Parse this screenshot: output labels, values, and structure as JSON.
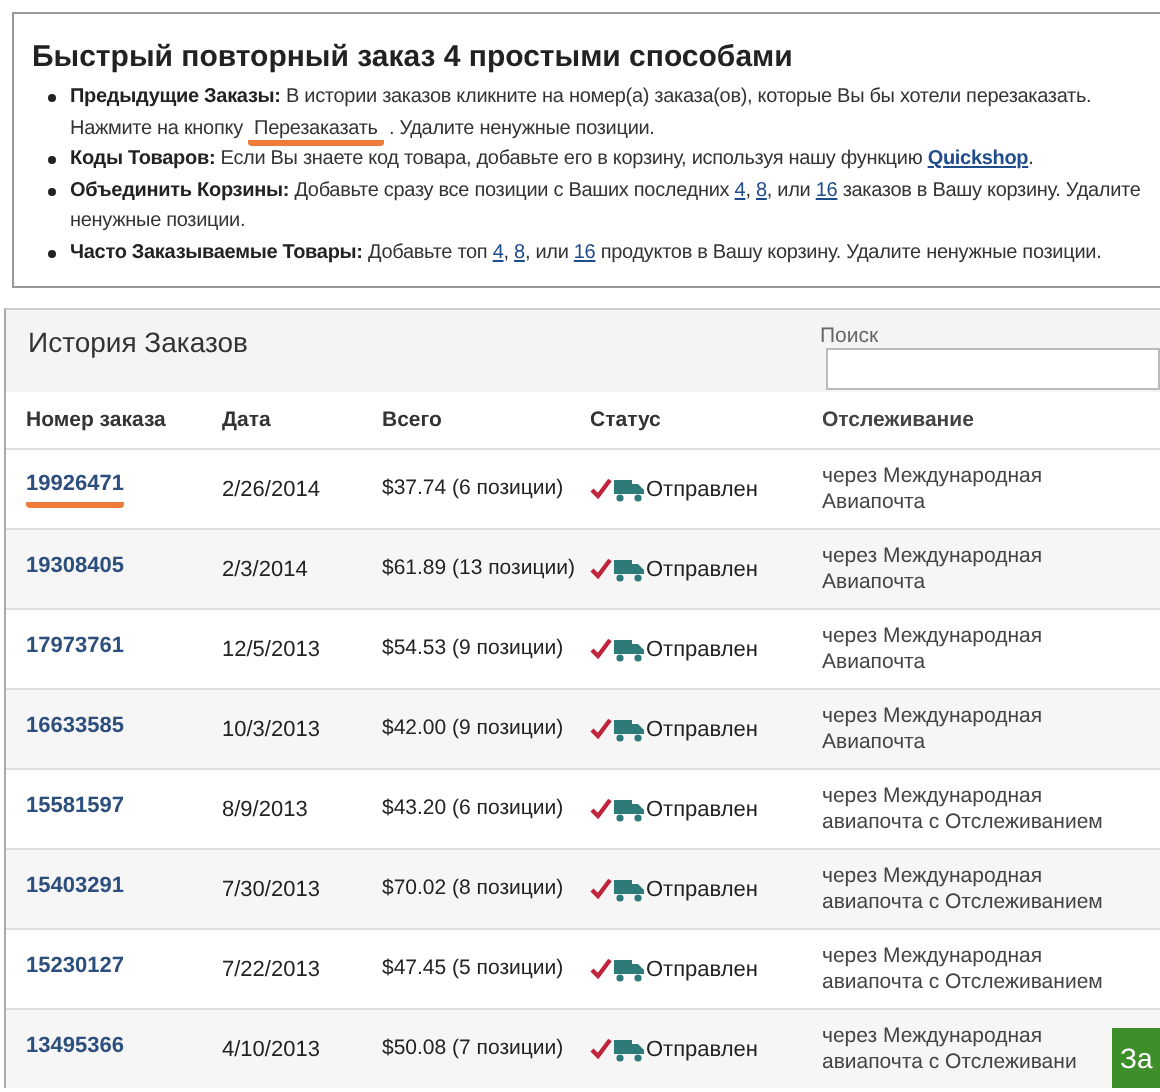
{
  "tips": {
    "title": "Быстрый повторный заказ 4 простыми способами",
    "items": [
      {
        "label": "Предыдущие Заказы:",
        "parts": [
          {
            "kind": "text",
            "text": " В истории заказов кликните на номер(а) заказа(ов), которые Вы бы хотели перезаказать. Нажмите на кнопку "
          },
          {
            "kind": "button",
            "text": "Перезаказать",
            "highlighted": true
          },
          {
            "kind": "text",
            "text": " . Удалите ненужные позиции."
          }
        ]
      },
      {
        "label": "Коды Товаров:",
        "parts": [
          {
            "kind": "text",
            "text": " Если Вы знаете код товара, добавьте его в корзину, используя нашу функцию "
          },
          {
            "kind": "strong-link",
            "text": "Quickshop"
          },
          {
            "kind": "text",
            "text": "."
          }
        ]
      },
      {
        "label": "Объединить Корзины:",
        "parts": [
          {
            "kind": "text",
            "text": " Добавьте сразу все позиции с Ваших последних "
          },
          {
            "kind": "link",
            "text": "4"
          },
          {
            "kind": "text",
            "text": ", "
          },
          {
            "kind": "link",
            "text": "8"
          },
          {
            "kind": "text",
            "text": ", или "
          },
          {
            "kind": "link",
            "text": "16"
          },
          {
            "kind": "text",
            "text": " заказов в Вашу корзину. Удалите ненужные позиции."
          }
        ]
      },
      {
        "label": "Часто Заказываемые Товары:",
        "parts": [
          {
            "kind": "text",
            "text": " Добавьте топ "
          },
          {
            "kind": "link",
            "text": "4"
          },
          {
            "kind": "text",
            "text": ", "
          },
          {
            "kind": "link",
            "text": "8"
          },
          {
            "kind": "text",
            "text": ", или "
          },
          {
            "kind": "link",
            "text": "16"
          },
          {
            "kind": "text",
            "text": " продуктов в Вашу корзину. Удалите ненужные позиции."
          }
        ]
      }
    ]
  },
  "history": {
    "title": "История Заказов",
    "search": {
      "label": "Поиск"
    },
    "columns": [
      "Номер заказа",
      "Дата",
      "Всего",
      "Статус",
      "Отслеживание"
    ],
    "rows": [
      {
        "order": "19926471",
        "highlighted": true,
        "date": "2/26/2014",
        "total": "$37.74 (6 позиции)",
        "status": "Отправлен",
        "tracking": "через Международная Авиапочта"
      },
      {
        "order": "19308405",
        "highlighted": false,
        "date": "2/3/2014",
        "total": "$61.89 (13 позиции)",
        "status": "Отправлен",
        "tracking": "через Международная Авиапочта"
      },
      {
        "order": "17973761",
        "highlighted": false,
        "date": "12/5/2013",
        "total": "$54.53 (9 позиции)",
        "status": "Отправлен",
        "tracking": "через Международная Авиапочта"
      },
      {
        "order": "16633585",
        "highlighted": false,
        "date": "10/3/2013",
        "total": "$42.00 (9 позиции)",
        "status": "Отправлен",
        "tracking": "через Международная Авиапочта"
      },
      {
        "order": "15581597",
        "highlighted": false,
        "date": "8/9/2013",
        "total": "$43.20 (6 позиции)",
        "status": "Отправлен",
        "tracking": "через Международная авиапочта с Отслеживанием"
      },
      {
        "order": "15403291",
        "highlighted": false,
        "date": "7/30/2013",
        "total": "$70.02 (8 позиции)",
        "status": "Отправлен",
        "tracking": "через Международная авиапочта с Отслеживанием"
      },
      {
        "order": "15230127",
        "highlighted": false,
        "date": "7/22/2013",
        "total": "$47.45 (5 позиции)",
        "status": "Отправлен",
        "tracking": "через Международная авиапочта с Отслеживанием"
      },
      {
        "order": "13495366",
        "highlighted": false,
        "date": "4/10/2013",
        "total": "$50.08 (7 позиции)",
        "status": "Отправлен",
        "tracking": "через Международная авиапочта с Отслеживани"
      }
    ],
    "side_button": "За"
  }
}
